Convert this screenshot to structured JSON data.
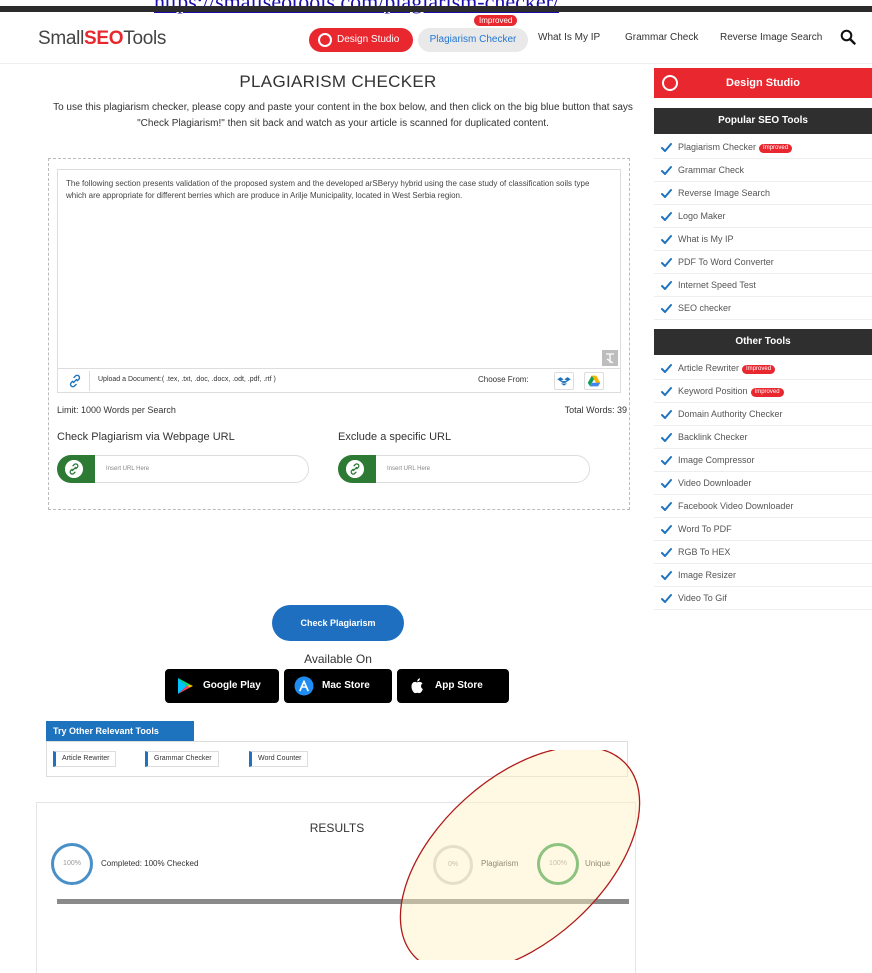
{
  "url_bar": {
    "url": "https://smallseotools.com/plagiarism-checker/"
  },
  "nav": {
    "logo_prefix": "Small",
    "logo_seo": "SEO",
    "logo_suffix": "Tools",
    "design_studio": "Design Studio",
    "plagiarism_checker": "Plagiarism Checker",
    "improved_badge": "Improved",
    "links": [
      "What Is My IP",
      "Grammar Check",
      "Reverse Image Search"
    ]
  },
  "main": {
    "title": "PLAGIARISM CHECKER",
    "intro": "To use this plagiarism checker, please copy and paste your content in the box below, and then click on the big blue button that says \"Check Plagiarism!\" then sit back and watch as your article is scanned for duplicated content.",
    "content_text": "The following section presents validation of the proposed system and the developed arSBeryy hybrid using the case study of classification soils type which are appropriate for different berries which are produce in Arilje Municipality, located in West Serbia region.",
    "upload_label": "Upload a Document:( .tex, .txt, .doc, .docx, .odt, .pdf, .rtf )",
    "choose_from": "Choose From:",
    "limit": "Limit: 1000 Words per Search",
    "total_words": "Total Words: 39",
    "check_url_label": "Check Plagiarism via Webpage URL",
    "exclude_url_label": "Exclude a specific URL",
    "url_placeholder_1": "Insert URL Here",
    "url_placeholder_2": "Insert URL Here",
    "check_button": "Check Plagiarism",
    "available_on": "Available On",
    "stores": [
      "Google Play",
      "Mac Store",
      "App Store"
    ],
    "other_tools_header": "Try Other Relevant Tools",
    "other_tools": [
      "Article Rewriter",
      "Grammar Checker",
      "Word Counter"
    ]
  },
  "results": {
    "title": "RESULTS",
    "completed_pct": "100%",
    "completed_label": "Completed: 100% Checked",
    "plagiarism_pct": "0%",
    "plagiarism_label": "Plagiarism",
    "unique_pct": "100%",
    "unique_label": "Unique",
    "progress": 1.0
  },
  "sidebar": {
    "design_studio": "Design Studio",
    "popular_header": "Popular SEO Tools",
    "popular": [
      "Plagiarism Checker",
      "Grammar Check",
      "Reverse Image Search",
      "Logo Maker",
      "What is My IP",
      "PDF To Word Converter",
      "Internet Speed Test",
      "SEO checker"
    ],
    "other_header": "Other Tools",
    "other": [
      "Article Rewriter",
      "Keyword Position",
      "Domain Authority Checker",
      "Backlink Checker",
      "Image Compressor",
      "Video Downloader",
      "Facebook Video Downloader",
      "Word To PDF",
      "RGB To HEX",
      "Image Resizer",
      "Video To Gif"
    ],
    "badge": "Improved"
  },
  "colors": {
    "brand_red": "#e8272f",
    "brand_blue": "#1e73be",
    "button_blue": "#1f6fc1",
    "url_green": "#2c7a34",
    "sidebar_header": "#2f2f2f",
    "annotation": "#b01a1a"
  },
  "icons": [
    "search-icon",
    "link-icon",
    "dropbox-icon",
    "google-drive-icon",
    "clear-text-icon",
    "check-icon",
    "google-play-icon",
    "mac-store-icon",
    "apple-icon",
    "design-studio-icon"
  ]
}
